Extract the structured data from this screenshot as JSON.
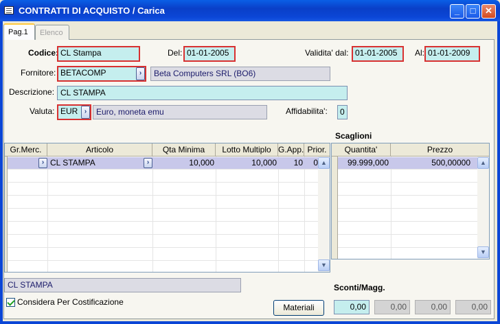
{
  "window": {
    "title": "CONTRATTI DI ACQUISTO / Carica",
    "minimize": "_",
    "maximize": "□",
    "close": "✕",
    "icon": "window-app-icon"
  },
  "tabs": [
    {
      "label": "Pag.1",
      "active": true
    },
    {
      "label": "Elenco",
      "active": false
    }
  ],
  "form": {
    "codice_label": "Codice:",
    "codice_value": "CL Stampa",
    "del_label": "Del:",
    "del_value": "01-01-2005",
    "validita_label": "Validita' dal:",
    "validita_value": "01-01-2005",
    "al_label": "Al:",
    "al_value": "01-01-2009",
    "fornitore_label": "Fornitore:",
    "fornitore_value": "BETACOMP",
    "fornitore_desc": "Beta Computers SRL (BO6)",
    "descrizione_label": "Descrizione:",
    "descrizione_value": "CL STAMPA",
    "valuta_label": "Valuta:",
    "valuta_value": "EUR",
    "valuta_desc": "Euro, moneta emu",
    "affidabilita_label": "Affidabilita':",
    "affidabilita_value": "0",
    "lookup_glyph": "›"
  },
  "main_grid": {
    "columns": [
      "Gr.Merc.",
      "Articolo",
      "Qta Minima",
      "Lotto Multiplo",
      "G.App.",
      "Prior."
    ],
    "rows": [
      {
        "gr_merc": "",
        "articolo": "CL STAMPA",
        "qta_minima": "10,000",
        "lotto_multiplo": "10,000",
        "g_app": "10",
        "prior": "0"
      }
    ]
  },
  "scaglioni": {
    "title": "Scaglioni",
    "columns": [
      "Quantita'",
      "Prezzo"
    ],
    "rows": [
      {
        "quantita": "99.999,000",
        "prezzo": "500,00000"
      }
    ]
  },
  "scroll": {
    "up": "▲",
    "down": "▼"
  },
  "footer": {
    "article_desc": "CL STAMPA",
    "considera_label": "Considera Per Costificazione",
    "considera_checked": true,
    "materiali_label": "Materiali",
    "sconti_label": "Sconti/Magg.",
    "sconti_values": [
      "0,00",
      "0,00",
      "0,00",
      "0,00"
    ]
  }
}
